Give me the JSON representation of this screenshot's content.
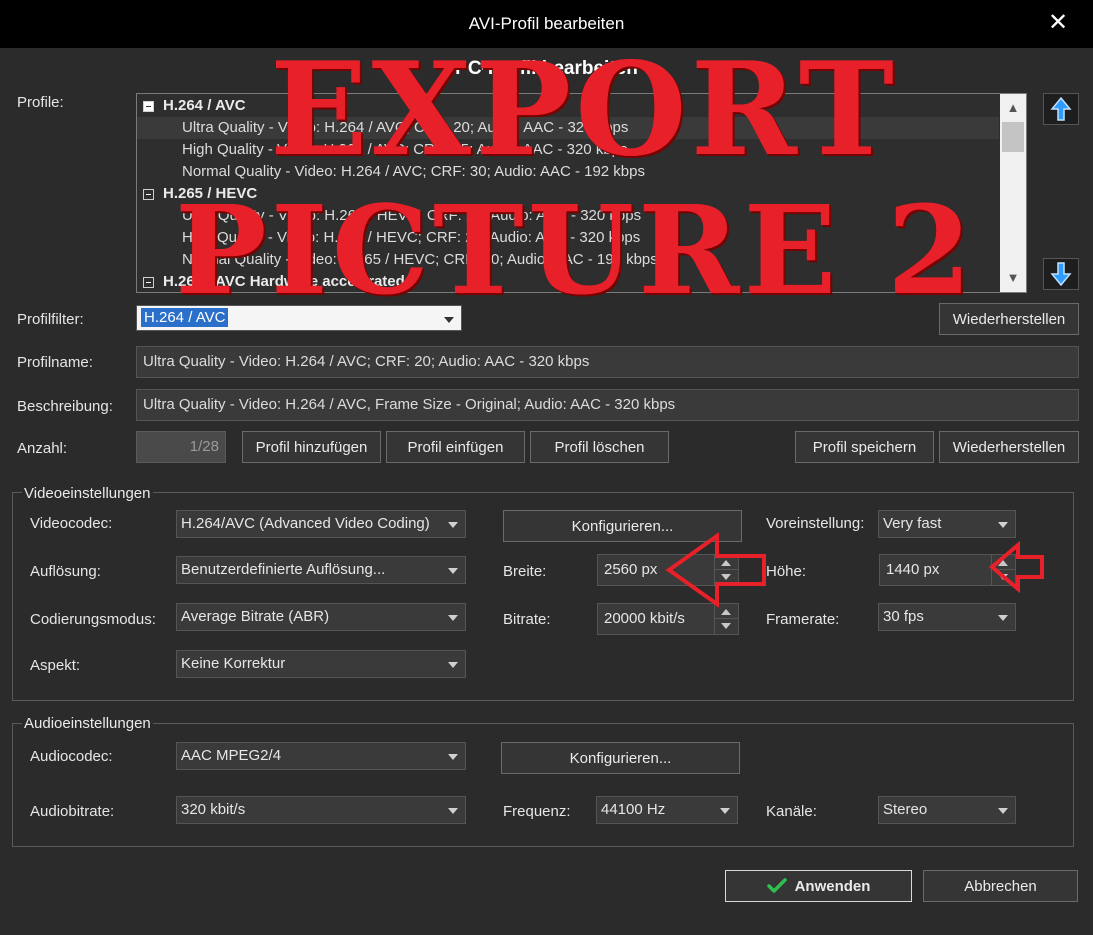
{
  "window": {
    "title": "AVI-Profil bearbeiten",
    "heading": "PC-Profil bearbeiten",
    "close_glyph": "✕"
  },
  "profiles": {
    "label": "Profile:",
    "list": [
      {
        "kind": "group",
        "text": "H.264 / AVC"
      },
      {
        "kind": "item",
        "text": "Ultra Quality - Video: H.264 / AVC; CRF: 20; Audio: AAC - 320 kbps",
        "selected": true
      },
      {
        "kind": "item",
        "text": "High Quality - Video: H.264 / AVC; CRF: 25; Audio: AAC - 320 kbps"
      },
      {
        "kind": "item",
        "text": "Normal Quality - Video: H.264 / AVC; CRF: 30; Audio: AAC - 192 kbps"
      },
      {
        "kind": "group",
        "text": "H.265 / HEVC"
      },
      {
        "kind": "item",
        "text": "Ultra Quality - Video: H.265 / HEVC; CRF: 20; Audio: AAC - 320 kbps"
      },
      {
        "kind": "item",
        "text": "High Quality - Video: H.265 / HEVC; CRF: 25; Audio: AAC - 320 kbps"
      },
      {
        "kind": "item",
        "text": "Normal Quality - Video: H.265 / HEVC; CRF: 30; Audio: AAC - 192 kbps"
      },
      {
        "kind": "group",
        "text": "H.264 / AVC Hardware accelerated"
      }
    ],
    "move_up_icon": "arrow-up-icon",
    "move_down_icon": "arrow-down-icon"
  },
  "filter": {
    "label": "Profilfilter:",
    "value": "H.264 / AVC",
    "reset_label": "Wiederherstellen"
  },
  "profile_name": {
    "label": "Profilname:",
    "value": "Ultra Quality - Video: H.264 / AVC; CRF: 20; Audio: AAC - 320 kbps"
  },
  "description": {
    "label": "Beschreibung:",
    "value": "Ultra Quality - Video: H.264 / AVC, Frame Size - Original; Audio: AAC - 320 kbps"
  },
  "count": {
    "label": "Anzahl:",
    "value": "1/28",
    "add_label": "Profil hinzufügen",
    "insert_label": "Profil einfügen",
    "delete_label": "Profil löschen",
    "save_label": "Profil speichern",
    "restore_label": "Wiederherstellen"
  },
  "video": {
    "title": "Videoeinstellungen",
    "codec_label": "Videocodec:",
    "codec_value": "H.264/AVC (Advanced Video Coding)",
    "configure_label": "Konfigurieren...",
    "preset_label": "Voreinstellung:",
    "preset_value": "Very fast",
    "resolution_label": "Auflösung:",
    "resolution_value": "Benutzerdefinierte Auflösung...",
    "width_label": "Breite:",
    "width_value": "2560 px",
    "height_label": "Höhe:",
    "height_value": "1440 px",
    "mode_label": "Codierungsmodus:",
    "mode_value": "Average Bitrate (ABR)",
    "bitrate_label": "Bitrate:",
    "bitrate_value": "20000 kbit/s",
    "framerate_label": "Framerate:",
    "framerate_value": "30 fps",
    "aspect_label": "Aspekt:",
    "aspect_value": "Keine Korrektur"
  },
  "audio": {
    "title": "Audioeinstellungen",
    "codec_label": "Audiocodec:",
    "codec_value": "AAC MPEG2/4",
    "configure_label": "Konfigurieren...",
    "bitrate_label": "Audiobitrate:",
    "bitrate_value": "320 kbit/s",
    "frequency_label": "Frequenz:",
    "frequency_value": "44100 Hz",
    "channels_label": "Kanäle:",
    "channels_value": "Stereo"
  },
  "footer": {
    "apply_label": "Anwenden",
    "cancel_label": "Abbrechen"
  },
  "overlay": {
    "line1": "EXPORT",
    "line2": "PICTURE 2"
  },
  "colors": {
    "accent_red": "#e8202a",
    "selection_blue": "#2a6fc9",
    "apply_check_green": "#2fbf4f"
  }
}
